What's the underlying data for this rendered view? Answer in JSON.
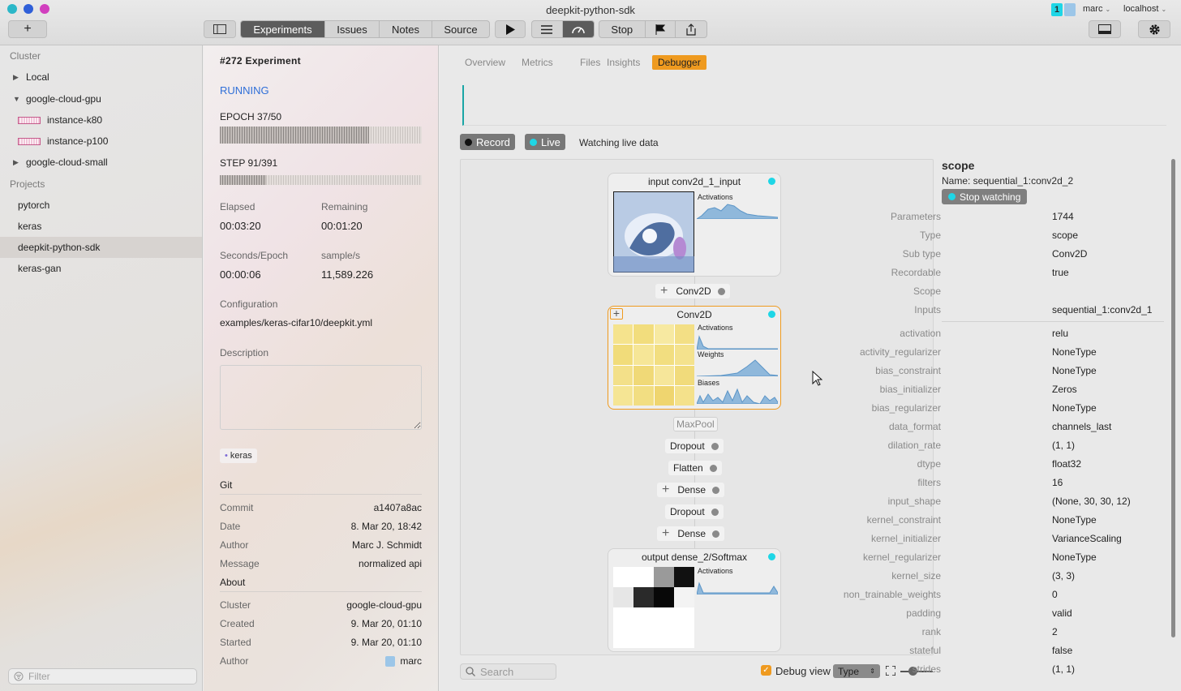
{
  "window": {
    "title": "deepkit-python-sdk"
  },
  "toolbar": {
    "add": "+",
    "tabs": [
      "Experiments",
      "Issues",
      "Notes",
      "Source"
    ],
    "active_tab": "Experiments",
    "stop": "Stop",
    "user": "marc",
    "host": "localhost",
    "badge": "1"
  },
  "sidebar": {
    "cluster_heading": "Cluster",
    "clusters": [
      {
        "label": "Local",
        "expanded": false
      },
      {
        "label": "google-cloud-gpu",
        "expanded": true
      },
      {
        "label": "google-cloud-small",
        "expanded": false
      }
    ],
    "instances": [
      "instance-k80",
      "instance-p100"
    ],
    "projects_heading": "Projects",
    "projects": [
      "pytorch",
      "keras",
      "deepkit-python-sdk",
      "keras-gan"
    ],
    "selected_project": "deepkit-python-sdk",
    "filter_placeholder": "Filter"
  },
  "experiment": {
    "title": "#272 Experiment",
    "status": "RUNNING",
    "epoch_label": "EPOCH 37/50",
    "epoch_progress": 0.74,
    "step_label": "STEP 91/391",
    "step_progress": 0.23,
    "elapsed_label": "Elapsed",
    "elapsed": "00:03:20",
    "remaining_label": "Remaining",
    "remaining": "00:01:20",
    "spe_label": "Seconds/Epoch",
    "spe": "00:00:06",
    "sps_label": "sample/s",
    "sps": "11,589.226",
    "config_label": "Configuration",
    "config": "examples/keras-cifar10/deepkit.yml",
    "desc_label": "Description",
    "tag": "keras",
    "git_heading": "Git",
    "git": [
      {
        "k": "Commit",
        "v": "a1407a8ac"
      },
      {
        "k": "Date",
        "v": "8. Mar 20, 18:42"
      },
      {
        "k": "Author",
        "v": "Marc J. Schmidt"
      },
      {
        "k": "Message",
        "v": "normalized api"
      }
    ],
    "about_heading": "About",
    "about": [
      {
        "k": "Cluster",
        "v": "google-cloud-gpu"
      },
      {
        "k": "Created",
        "v": "9. Mar 20, 01:10"
      },
      {
        "k": "Started",
        "v": "9. Mar 20, 01:10"
      },
      {
        "k": "Author",
        "v": "marc"
      }
    ]
  },
  "main": {
    "tabs": [
      "Overview",
      "Metrics",
      "Files",
      "Insights",
      "Debugger"
    ],
    "active_tab": "Debugger",
    "record": "Record",
    "live": "Live",
    "watching": "Watching live data",
    "search_placeholder": "Search",
    "debug_view": "Debug view",
    "type_select": "Type",
    "debug_checked": true
  },
  "graph": {
    "input_title": "input conv2d_1_input",
    "conv_title": "Conv2D",
    "output_title": "output dense_2/Softmax",
    "activations": "Activations",
    "weights": "Weights",
    "biases": "Biases",
    "layers": [
      "Conv2D",
      "MaxPool",
      "Dropout",
      "Flatten",
      "Dense",
      "Dropout",
      "Dense"
    ]
  },
  "scope": {
    "title": "scope",
    "name": "Name: sequential_1:conv2d_2",
    "stop_watching": "Stop watching",
    "props": [
      {
        "k": "Parameters",
        "v": "1744"
      },
      {
        "k": "Type",
        "v": "scope"
      },
      {
        "k": "Sub type",
        "v": "Conv2D"
      },
      {
        "k": "Recordable",
        "v": "true"
      },
      {
        "k": "Scope",
        "v": ""
      },
      {
        "k": "Inputs",
        "v": "sequential_1:conv2d_1"
      }
    ],
    "config": [
      {
        "k": "activation",
        "v": "relu"
      },
      {
        "k": "activity_regularizer",
        "v": "NoneType"
      },
      {
        "k": "bias_constraint",
        "v": "NoneType"
      },
      {
        "k": "bias_initializer",
        "v": "Zeros"
      },
      {
        "k": "bias_regularizer",
        "v": "NoneType"
      },
      {
        "k": "data_format",
        "v": "channels_last"
      },
      {
        "k": "dilation_rate",
        "v": "(1, 1)"
      },
      {
        "k": "dtype",
        "v": "float32"
      },
      {
        "k": "filters",
        "v": "16"
      },
      {
        "k": "input_shape",
        "v": "(None, 30, 30, 12)"
      },
      {
        "k": "kernel_constraint",
        "v": "NoneType"
      },
      {
        "k": "kernel_initializer",
        "v": "VarianceScaling"
      },
      {
        "k": "kernel_regularizer",
        "v": "NoneType"
      },
      {
        "k": "kernel_size",
        "v": "(3, 3)"
      },
      {
        "k": "non_trainable_weights",
        "v": "0"
      },
      {
        "k": "padding",
        "v": "valid"
      },
      {
        "k": "rank",
        "v": "2"
      },
      {
        "k": "stateful",
        "v": "false"
      },
      {
        "k": "strides",
        "v": "(1, 1)"
      }
    ]
  },
  "colors": {
    "accent": "#ef9a1f",
    "live": "#1ed6e6",
    "traffic": [
      "#2bb7c8",
      "#2f5fd8",
      "#d13fbe"
    ]
  }
}
